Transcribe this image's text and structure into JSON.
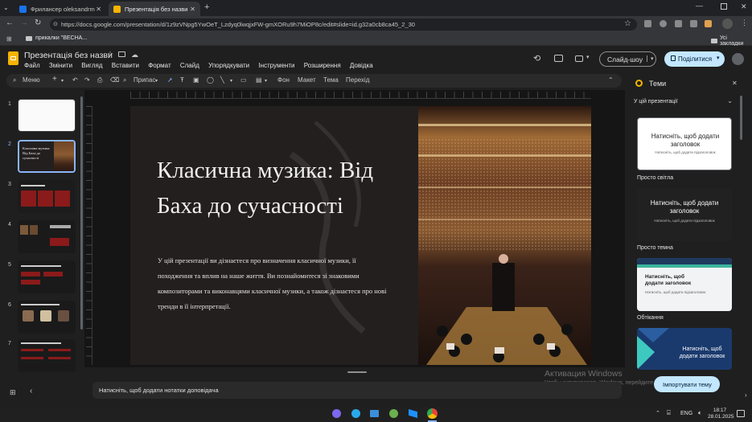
{
  "browser": {
    "tabs": [
      {
        "title": "Фрилансер oleksandrmazula1",
        "active": false
      },
      {
        "title": "Презентація без назви - Goog",
        "active": true
      }
    ],
    "url": "https://docs.google.com/presentation/d/1z9zVNpg5YwOeT_Lzdyq0lwqjxFW-gmXORu9h7MiOP8c/edit#slide=id.g32a0cb8ca45_2_30",
    "bookmark": "прикалки \"ВЕСНА...",
    "all_bookmarks": "Усі закладки"
  },
  "docs": {
    "title": "Презентація без назви",
    "menu": [
      "Файл",
      "Змінити",
      "Вигляд",
      "Вставити",
      "Формат",
      "Слайд",
      "Упорядкувати",
      "Інструменти",
      "Розширення",
      "Довідка"
    ],
    "slideshow_label": "Слайд-шоу",
    "share_label": "Поділитися",
    "toolbar": {
      "menu_label": "Меню",
      "zoom_label": "Припас",
      "background": "Фон",
      "layout": "Макет",
      "theme": "Тема",
      "transition": "Перехід"
    }
  },
  "slides": {
    "numbers": [
      "1",
      "2",
      "3",
      "4",
      "5",
      "6",
      "7"
    ],
    "thumb2_title": "Класична музика: Від Баха до сучасності"
  },
  "current_slide": {
    "title": "Класична музика: Від Баха до сучасності",
    "body": "У цій презентації ви дізнаєтеся про визначення класичної музики, її походження та вплив на наше життя. Ви познайомитеся зі знаковими композиторами та виконавцями класичної музики, а також дізнаєтеся про нові тренди в її інтерпретації."
  },
  "notes_placeholder": "Натисніть, щоб додати нотатки доповідача",
  "themes_panel": {
    "title": "Теми",
    "section": "У цій презентації",
    "themes": [
      {
        "name": "Просто світла",
        "card_title": "Натисніть, щоб додати заголовок",
        "card_subtitle": "Натисніть, щоб додати підзаголовок"
      },
      {
        "name": "Просто темна",
        "card_title": "Натисніть, щоб додати заголовок",
        "card_subtitle": "Натисніть, щоб додати підзаголовок"
      },
      {
        "name": "Обтікання",
        "card_title": "Натисніть, щоб додати заголовок",
        "card_subtitle": "Натисніть, щоб додати підзаголовок"
      },
      {
        "name": "",
        "card_title": "Натисніть, щоб додати заголовок",
        "card_subtitle": ""
      }
    ],
    "import_label": "Імпортувати тему"
  },
  "watermark": {
    "line1": "Активация Windows",
    "line2": "Чтобы активировать Windows, перейдите"
  },
  "taskbar": {
    "lang": "ENG",
    "time": "18:17",
    "date": "28.01.2025"
  },
  "colors": {
    "accent": "#8ab4f8",
    "share_button": "#c2e7ff",
    "slide_bg": "#231f1f"
  }
}
